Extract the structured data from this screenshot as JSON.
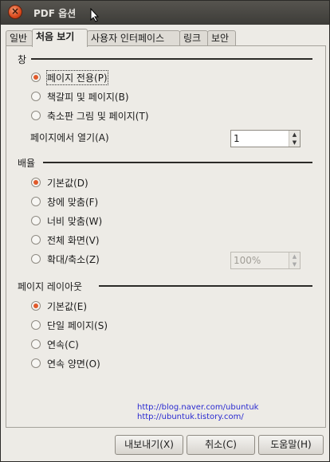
{
  "window": {
    "title": "PDF 옵션"
  },
  "tabs": [
    {
      "label": "일반"
    },
    {
      "label": "처음 보기"
    },
    {
      "label": "사용자 인터페이스"
    },
    {
      "label": "링크"
    },
    {
      "label": "보안"
    }
  ],
  "window_section": {
    "title": "창",
    "options": [
      {
        "label": "페이지 전용(P)",
        "selected": true
      },
      {
        "label": "책갈피 및 페이지(B)",
        "selected": false
      },
      {
        "label": "축소판 그림 및 페이지(T)",
        "selected": false
      }
    ],
    "open_on_page_label": "페이지에서 열기(A)",
    "open_on_page_value": "1"
  },
  "magnification": {
    "title": "배율",
    "options": [
      {
        "label": "기본값(D)",
        "selected": true
      },
      {
        "label": "창에 맞춤(F)",
        "selected": false
      },
      {
        "label": "너비 맞춤(W)",
        "selected": false
      },
      {
        "label": "전체 화면(V)",
        "selected": false
      },
      {
        "label": "확대/축소(Z)",
        "selected": false
      }
    ],
    "zoom_value": "100%"
  },
  "page_layout": {
    "title": "페이지 레이아웃",
    "options": [
      {
        "label": "기본값(E)",
        "selected": true
      },
      {
        "label": "단일 페이지(S)",
        "selected": false
      },
      {
        "label": "연속(C)",
        "selected": false
      },
      {
        "label": "연속 양면(O)",
        "selected": false
      }
    ]
  },
  "watermark_links": [
    "http://blog.naver.com/ubuntuk",
    "http://ubuntuk.tistory.com/"
  ],
  "buttons": {
    "export": "내보내기(X)",
    "cancel": "취소(C)",
    "help": "도움말(H)"
  },
  "colors": {
    "radio_selected": "#e05a2b",
    "titlebar": "#3d3c38",
    "link": "#2a2ad0"
  }
}
